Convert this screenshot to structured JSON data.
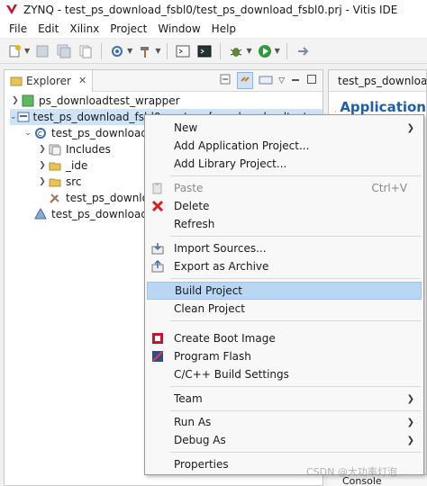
{
  "window": {
    "title": "ZYNQ - test_ps_download_fsbl0/test_ps_download_fsbl0.prj - Vitis IDE"
  },
  "menubar": [
    "File",
    "Edit",
    "Xilinx",
    "Project",
    "Window",
    "Help"
  ],
  "explorer": {
    "tab_label": "Explorer",
    "tree": [
      {
        "label": "ps_downloadtest_wrapper"
      },
      {
        "label": "test_ps_download_fsbl0_system [ ps_downloadtest_wrapper"
      },
      {
        "label": "test_ps_download_f"
      },
      {
        "label": "Includes"
      },
      {
        "label": "_ide"
      },
      {
        "label": "src"
      },
      {
        "label": "test_ps_download"
      },
      {
        "label": "test_ps_download_f"
      }
    ]
  },
  "right_panel": {
    "tab_label": "test_ps_downloa",
    "title": "Application",
    "console_label": "Console"
  },
  "context_menu": {
    "items": [
      {
        "label": "New",
        "arrow": "❯"
      },
      {
        "label": "Add Application Project..."
      },
      {
        "label": "Add Library Project..."
      },
      {
        "label": "Paste",
        "shortcut": "Ctrl+V"
      },
      {
        "label": "Delete"
      },
      {
        "label": "Refresh"
      },
      {
        "label": "Import Sources..."
      },
      {
        "label": "Export as Archive"
      },
      {
        "label": "Build Project"
      },
      {
        "label": "Clean Project"
      },
      {
        "label": "Create Boot Image"
      },
      {
        "label": "Program Flash"
      },
      {
        "label": "C/C++ Build Settings"
      },
      {
        "label": "Team",
        "arrow": "❯"
      },
      {
        "label": "Run As",
        "arrow": "❯"
      },
      {
        "label": "Debug As",
        "arrow": "❯"
      },
      {
        "label": "Properties"
      }
    ]
  },
  "watermark": "CSDN @大功率灯泡",
  "colors": {
    "highlight": "#b9d6f3",
    "accent": "#1f5fa8",
    "run_green": "#2e9b3a",
    "delete_red": "#d42020"
  }
}
